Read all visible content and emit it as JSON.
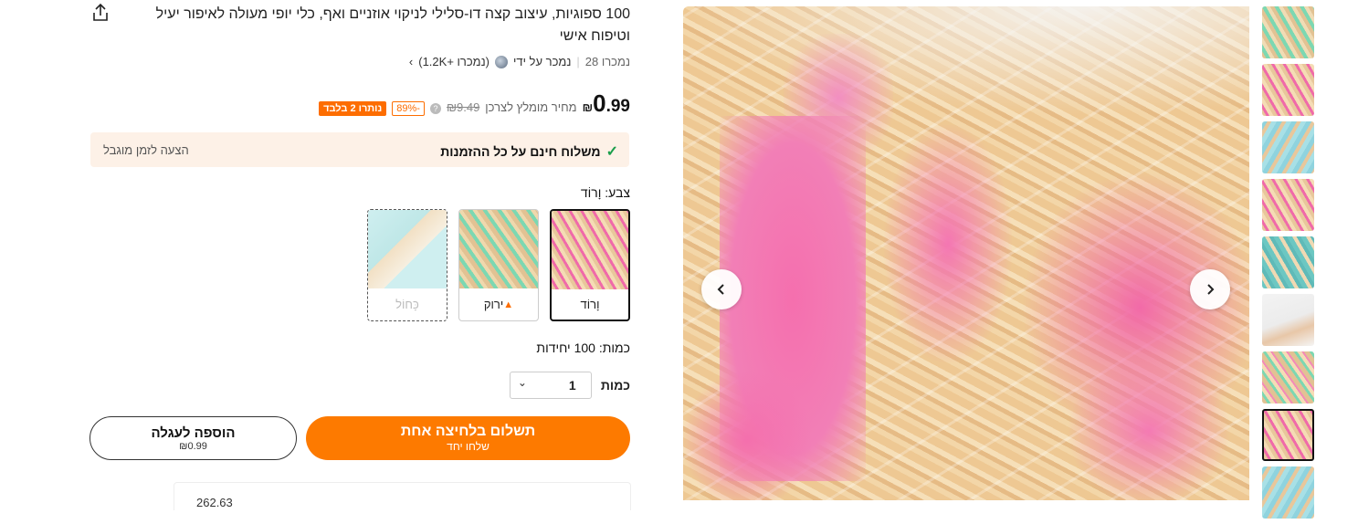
{
  "product": {
    "title": "100 ספוגיות, עיצוב קצה דו-סלילי לניקוי אוזניים ואף, כלי יופי מעולה לאיפור יעיל וטיפוח אישי",
    "sold_count": "נמכרו 28",
    "sold_by_label": "נמכר על ידי",
    "seller_sales": "(נמכרו +1.2K)",
    "seller_chevron": "›"
  },
  "price": {
    "currency": "₪",
    "integer": "0",
    "decimal": ".99",
    "rrp_label": "מחיר מומלץ לצרכן",
    "original": "₪9.49",
    "discount": "-89%",
    "stock_badge": "נותרו 2 בלבד"
  },
  "shipping": {
    "free_text": "משלוח חינם על כל ההזמנות",
    "limited_offer": "הצעה לזמן מוגבל"
  },
  "color": {
    "label": "צבע: וָרוֹד",
    "options": [
      {
        "label": "וָרוֹד",
        "state": "selected"
      },
      {
        "label": "ירוק",
        "state": "hot",
        "icon": "fire-icon"
      },
      {
        "label": "כָּחוֹל",
        "state": "disabled"
      }
    ]
  },
  "quantity": {
    "units_label": "כמות: 100 יחידות",
    "qty_label": "כמות",
    "value": "1"
  },
  "actions": {
    "buy_now": "תשלום בלחיצה אחת",
    "buy_now_sub": "שלחו יחד",
    "add_to_cart": "הוספה לעגלה",
    "add_to_cart_price": "₪0.99"
  },
  "bottom_card": {
    "text": "262.63"
  },
  "colors": {
    "accent": "#fd7a00",
    "discount": "#fd6d00",
    "banner_bg": "#fdf1e7",
    "check": "#1a9e4b"
  },
  "thumbnails": [
    {
      "name": "green-swabs",
      "active": false
    },
    {
      "name": "pink-swabs",
      "active": false
    },
    {
      "name": "blue-swabs",
      "active": false
    },
    {
      "name": "pink-swabs-2",
      "active": false
    },
    {
      "name": "teal-swabs",
      "active": false
    },
    {
      "name": "hand-swab",
      "active": false
    },
    {
      "name": "mixed-swabs",
      "active": false
    },
    {
      "name": "pink-swabs-3",
      "active": true
    },
    {
      "name": "blue-swabs-2",
      "active": false
    }
  ]
}
